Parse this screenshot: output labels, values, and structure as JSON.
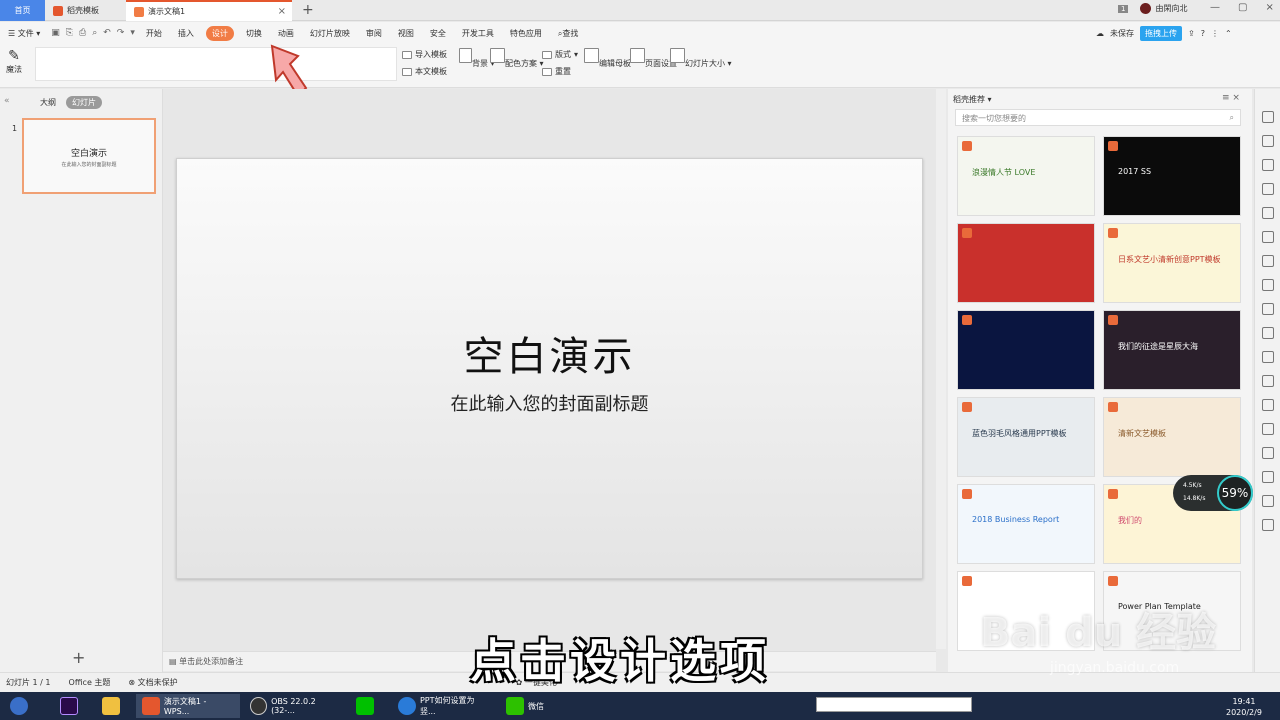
{
  "tabs": {
    "home": "首页",
    "template": "稻壳模板",
    "document": "演示文稿1",
    "close": "×",
    "add": "+"
  },
  "titlebar": {
    "badge": "1",
    "user": "由閑向北",
    "min": "—",
    "max": "▢",
    "close": "×"
  },
  "menu": {
    "file": "文件",
    "items": [
      "开始",
      "插入",
      "设计",
      "切换",
      "动画",
      "幻灯片放映",
      "审阅",
      "视图",
      "安全",
      "开发工具",
      "特色应用"
    ],
    "search": "查找",
    "unsaved": "未保存",
    "upload": "拖拽上传",
    "help": "?"
  },
  "ribbon": {
    "magic": "魔法",
    "import_template": "导入模板",
    "this_template": "本文模板",
    "background": "背景",
    "color_scheme": "配色方案",
    "layout": "版式",
    "reset": "重置",
    "edit_master": "编辑母板",
    "page_setup": "页面设置",
    "slide_size": "幻灯片大小"
  },
  "left_panel": {
    "outline": "大纲",
    "slides": "幻灯片",
    "slide_number": "1",
    "thumb_title": "空白演示",
    "thumb_sub": "在此输入您的封面副标题",
    "collapse": "«"
  },
  "slide": {
    "title": "空白演示",
    "subtitle": "在此输入您的封面副标题"
  },
  "notes": {
    "placeholder": "单击此处添加备注"
  },
  "right_panel": {
    "title": "稻壳推荐",
    "search_placeholder": "搜索一切您想要的",
    "cards": [
      {
        "text": "浪漫情人节 LOVE",
        "bg": "#f4f6ef",
        "color": "#3b7a2a"
      },
      {
        "text": "2017 SS",
        "bg": "#0b0b0b",
        "color": "#ffffff"
      },
      {
        "text": "",
        "bg": "#c9302c",
        "color": "#ffffff"
      },
      {
        "text": "日系文艺小清新创意PPT模板",
        "bg": "#fbf6d8",
        "color": "#c0392b"
      },
      {
        "text": "",
        "bg": "#0a1540",
        "color": "#ffffff"
      },
      {
        "text": "我们的征途是星辰大海",
        "bg": "#2a1f2b",
        "color": "#ffffff"
      },
      {
        "text": "蓝色羽毛风格通用PPT模板",
        "bg": "#e8ecef",
        "color": "#2a3b4f"
      },
      {
        "text": "清新文艺模板",
        "bg": "#f6ead8",
        "color": "#8a5a2b"
      },
      {
        "text": "2018 Business Report",
        "bg": "#f2f7fc",
        "color": "#2a6fc9"
      },
      {
        "text": "我们的",
        "bg": "#fdf4d6",
        "color": "#d04a6e"
      },
      {
        "text": "",
        "bg": "#ffffff",
        "color": "#b0191e"
      },
      {
        "text": "Power Plan Template",
        "bg": "#f6f6f6",
        "color": "#222222"
      }
    ]
  },
  "speed": {
    "up": "4.5K/s",
    "down": "14.8K/s",
    "percent": "59%"
  },
  "status": {
    "slide": "幻灯片 1 / 1",
    "theme": "Office 主题",
    "protect": "文档未保护",
    "beautify": "一键美化"
  },
  "taskbar": {
    "ppt": "演示文稿1 - WPS...",
    "obs": "OBS 22.0.2 (32-...",
    "browser": "PPT如何设置为竖...",
    "wechat": "微信",
    "time": "19:41",
    "date": "2020/2/9"
  },
  "overlay": {
    "caption": "点击设计选项",
    "watermark": "Bai du 经验",
    "watermark_url": "jingyan.baidu.com"
  },
  "colors": {
    "accent": "#f17c45",
    "wps_red": "#e4572e",
    "taskbar": "#1c2a44"
  }
}
